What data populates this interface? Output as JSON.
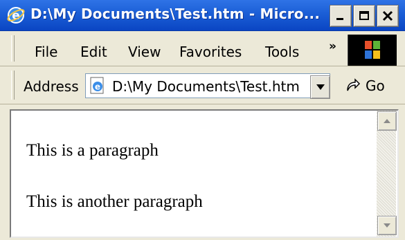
{
  "window": {
    "title": "D:\\My Documents\\Test.htm - Micro...",
    "title_icon": "ie-icon",
    "controls": [
      "minimize",
      "maximize",
      "close"
    ]
  },
  "menubar": {
    "items": [
      "File",
      "Edit",
      "View",
      "Favorites",
      "Tools"
    ],
    "chevron": "»"
  },
  "addressbar": {
    "label": "Address",
    "value": "D:\\My Documents\\Test.htm",
    "go_label": "Go"
  },
  "document": {
    "paragraphs": [
      "This is a paragraph",
      "This is another paragraph"
    ]
  },
  "colors": {
    "titlebar": "#1b5ed6",
    "chrome": "#ece9d8"
  }
}
